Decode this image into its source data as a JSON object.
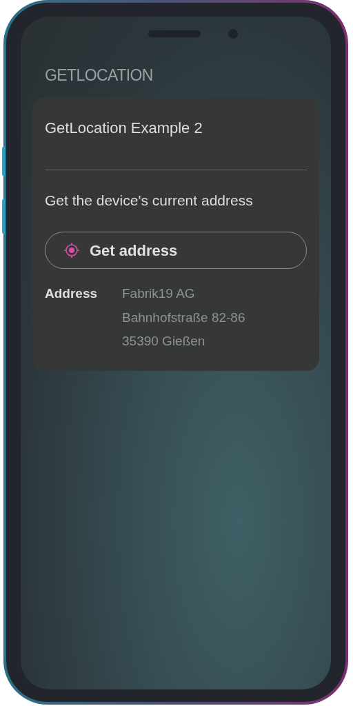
{
  "header": {
    "title": "GETLOCATION"
  },
  "card": {
    "title": "GetLocation Example 2",
    "description": "Get the device's current address",
    "button": {
      "label": "Get address"
    },
    "result": {
      "label": "Address",
      "lines": [
        "Fabrik19 AG",
        "Bahnhofstraße 82-86",
        "35390 Gießen"
      ]
    }
  }
}
